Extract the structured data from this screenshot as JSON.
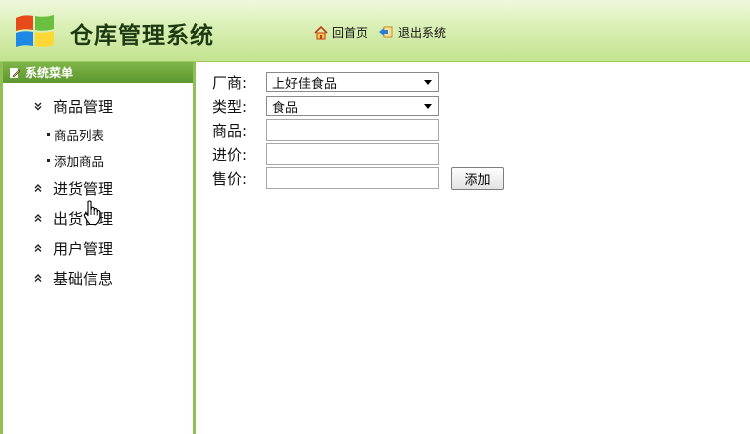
{
  "header": {
    "title": "仓库管理系统",
    "home_label": "回首页",
    "logout_label": "退出系统"
  },
  "sidebar": {
    "title": "系统菜单",
    "groups": [
      {
        "label": "商品管理",
        "expanded": true,
        "items": [
          "商品列表",
          "添加商品"
        ]
      },
      {
        "label": "进货管理",
        "expanded": false
      },
      {
        "label": "出货管理",
        "expanded": false
      },
      {
        "label": "用户管理",
        "expanded": false
      },
      {
        "label": "基础信息",
        "expanded": false
      }
    ]
  },
  "form": {
    "vendor_label": "厂商:",
    "vendor_value": "上好佳食品",
    "type_label": "类型:",
    "type_value": "食品",
    "product_label": "商品:",
    "product_value": "",
    "cost_label": "进价:",
    "cost_value": "",
    "price_label": "售价:",
    "price_value": "",
    "submit_label": "添加"
  },
  "colors": {
    "header_gradient_top": "#eef8dc",
    "header_gradient_bottom": "#c3e38f",
    "sidebar_border": "#8fc056",
    "sidebar_header": "#5d9730"
  }
}
